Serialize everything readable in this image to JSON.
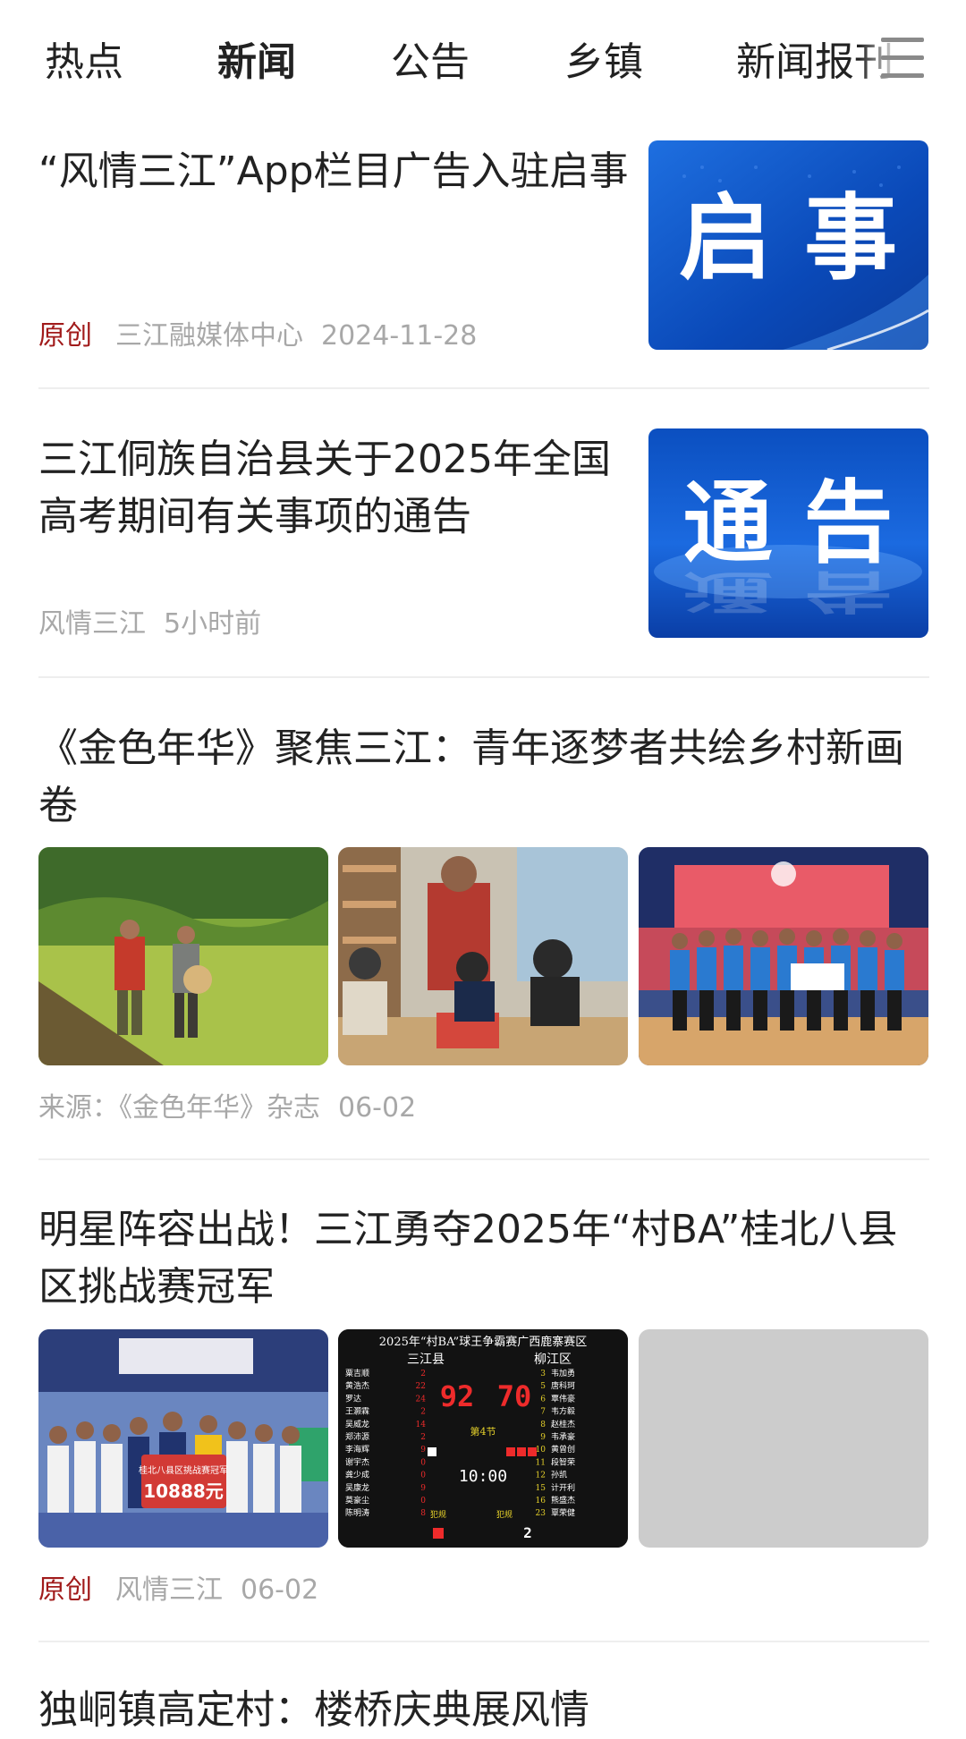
{
  "tabs": [
    {
      "label": "热点",
      "active": false
    },
    {
      "label": "新闻",
      "active": true
    },
    {
      "label": "公告",
      "active": false
    },
    {
      "label": "乡镇",
      "active": false
    },
    {
      "label": "新闻报刊",
      "active": false
    }
  ],
  "menu_icon": "hamburger-menu-icon",
  "articles": [
    {
      "title": "“风情三江”App栏目广告入驻启事",
      "tag": "原创",
      "source": "三江融媒体中心",
      "time": "2024-11-28",
      "thumb_text": "启 事"
    },
    {
      "title": "三江侗族自治县关于2025年全国高考期间有关事项的通告",
      "source": "风情三江",
      "time": "5小时前",
      "thumb_text": "通 告"
    },
    {
      "title": "《金色年华》聚焦三江：青年逐梦者共绘乡村新画卷",
      "source": "来源：《金色年华》杂志",
      "time": "06-02",
      "photos": [
        "rice-field-photo",
        "reading-children-photo",
        "team-award-photo"
      ]
    },
    {
      "title": "明星阵容出战！三江勇夺2025年“村BA”桂北八县区挑战赛冠军",
      "tag": "原创",
      "source": "风情三江",
      "time": "06-02",
      "photos": [
        "champion-team-photo",
        "scoreboard-photo",
        "placeholder-photo"
      ],
      "scoreboard": {
        "header": "2025年“村BA”球王争霸赛广西鹿寨赛区",
        "home": "三江县",
        "away": "柳江区",
        "home_score": "92",
        "away_score": "70",
        "period": "第4节",
        "clock": "10:00",
        "away_fouls": "2",
        "home_players": [
          "粟吉顺",
          "黄浩杰",
          "罗达",
          "王灏霖",
          "吴威龙",
          "郑沛源",
          "李海辉",
          "谢宇杰",
          "龚少成",
          "吴康龙",
          "莫豪尘",
          "陈明涛"
        ],
        "home_points": [
          "2",
          "22",
          "24",
          "2",
          "14",
          "2",
          "9",
          "0",
          "0",
          "9",
          "0",
          "8"
        ],
        "away_numbers": [
          "3",
          "5",
          "6",
          "7",
          "8",
          "9",
          "10",
          "11",
          "12",
          "15",
          "16",
          "23"
        ],
        "away_players": [
          "韦加勇",
          "唐科珂",
          "覃伟豪",
          "韦方毅",
          "赵桂杰",
          "韦承豪",
          "黄曾创",
          "段智荣",
          "孙凯",
          "计开利",
          "熊盛杰",
          "覃荣健"
        ],
        "fouls_label": "犯规",
        "banner_amount": "10888元",
        "banner_title": "桂北八县区挑战赛冠军"
      }
    },
    {
      "title": "独峒镇高定村：楼桥庆典展风情"
    }
  ]
}
